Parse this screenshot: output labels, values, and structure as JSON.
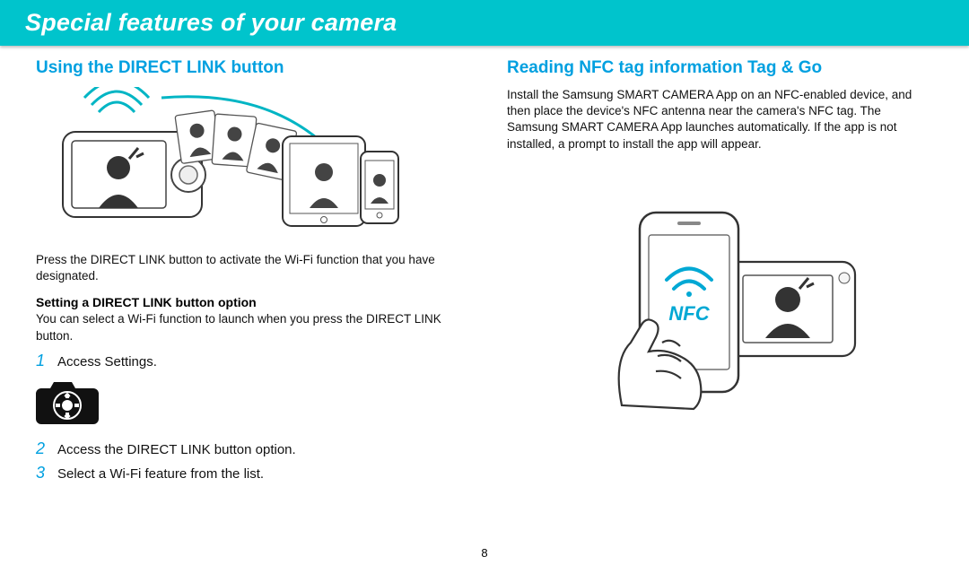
{
  "header": {
    "title": "Special features of your camera"
  },
  "left": {
    "section_title": "Using the DIRECT LINK button",
    "intro": "Press the DIRECT LINK button to activate the Wi-Fi function that you have designated.",
    "sub_heading": "Setting a DIRECT LINK button option",
    "sub_text": "You can select a Wi-Fi function to launch when you press the DIRECT LINK button.",
    "steps": [
      {
        "num": "1",
        "text": "Access Settings."
      },
      {
        "num": "2",
        "text": "Access the DIRECT LINK button option."
      },
      {
        "num": "3",
        "text": "Select a Wi-Fi feature from the list."
      }
    ]
  },
  "right": {
    "section_title": "Reading NFC tag information Tag & Go",
    "body": "Install the Samsung SMART CAMERA App on an NFC-enabled device, and then place the device's NFC antenna near the camera's NFC tag. The Samsung SMART CAMERA App launches automatically. If the app is not installed, a prompt to install the app will appear.",
    "nfc_label": "NFC"
  },
  "page_number": "8"
}
